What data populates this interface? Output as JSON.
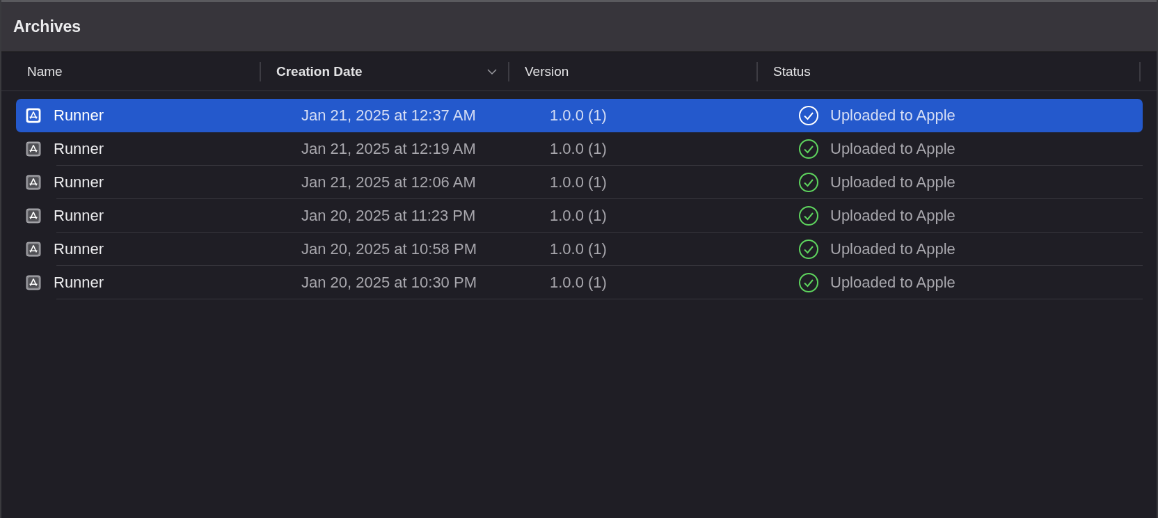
{
  "window": {
    "title": "Archives"
  },
  "table": {
    "columns": [
      {
        "label": "Name",
        "sorted": false
      },
      {
        "label": "Creation Date",
        "sorted": true
      },
      {
        "label": "Version",
        "sorted": false
      },
      {
        "label": "Status",
        "sorted": false
      }
    ],
    "rows": [
      {
        "name": "Runner",
        "date": "Jan 21, 2025 at 12:37 AM",
        "version": "1.0.0 (1)",
        "status": "Uploaded to Apple",
        "selected": true
      },
      {
        "name": "Runner",
        "date": "Jan 21, 2025 at 12:19 AM",
        "version": "1.0.0 (1)",
        "status": "Uploaded to Apple",
        "selected": false
      },
      {
        "name": "Runner",
        "date": "Jan 21, 2025 at 12:06 AM",
        "version": "1.0.0 (1)",
        "status": "Uploaded to Apple",
        "selected": false
      },
      {
        "name": "Runner",
        "date": "Jan 20, 2025 at 11:23 PM",
        "version": "1.0.0 (1)",
        "status": "Uploaded to Apple",
        "selected": false
      },
      {
        "name": "Runner",
        "date": "Jan 20, 2025 at 10:58 PM",
        "version": "1.0.0 (1)",
        "status": "Uploaded to Apple",
        "selected": false
      },
      {
        "name": "Runner",
        "date": "Jan 20, 2025 at 10:30 PM",
        "version": "1.0.0 (1)",
        "status": "Uploaded to Apple",
        "selected": false
      }
    ]
  }
}
